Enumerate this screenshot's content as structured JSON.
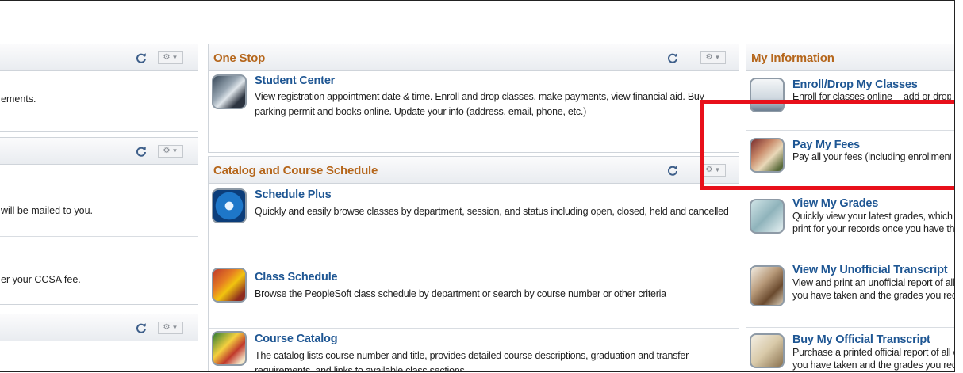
{
  "left_column": {
    "row1_text": "ements.",
    "row2_text": "will be mailed to you.",
    "row3_text": "er your CCSA fee."
  },
  "one_stop": {
    "title": "One Stop",
    "items": [
      {
        "title": "Student Center",
        "desc": "View registration appointment date & time. Enroll and drop classes, make payments, view financial aid. Buy parking permit and books online. Update your info (address, email, phone, etc.)"
      }
    ]
  },
  "catalog": {
    "title": "Catalog and Course Schedule",
    "items": [
      {
        "title": "Schedule Plus",
        "desc": "Quickly and easily browse classes by department, session, and status including open, closed, held and cancelled"
      },
      {
        "title": "Class Schedule",
        "desc": "Browse the PeopleSoft class schedule by department or search by course number or other criteria"
      },
      {
        "title": "Course Catalog",
        "desc": "The catalog lists course number and title, provides detailed course descriptions, graduation and transfer requirements, and links to available class sections."
      }
    ]
  },
  "my_info": {
    "title": "My Information",
    "items": [
      {
        "title": "Enroll/Drop My Classes",
        "desc": "Enroll for classes online -- add or drop classes"
      },
      {
        "title": "Pay My Fees",
        "desc": "Pay all your fees (including enrollment fees)"
      },
      {
        "title": "View My Grades",
        "desc": "Quickly view your latest grades, which you can print for your records once you have them."
      },
      {
        "title": "View My Unofficial Transcript",
        "desc": "View and print an unofficial report of all courses you have taken and the grades you received."
      },
      {
        "title": "Buy My Official Transcript",
        "desc": "Purchase a printed official report of all courses you have taken and the grades you received."
      }
    ]
  },
  "icons": {
    "refresh": "refresh-icon",
    "gear": "gear-icon",
    "menu_arrow": "chevron-down-icon"
  },
  "colors": {
    "pagelet_title": "#b5661b",
    "link": "#1e5693",
    "highlight": "#e8101a"
  }
}
